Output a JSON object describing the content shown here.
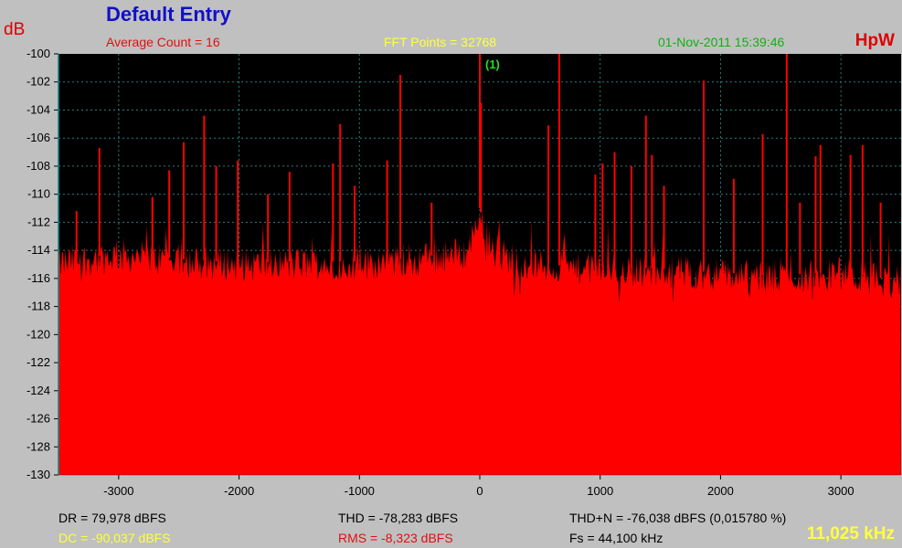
{
  "header": {
    "title": "Default Entry",
    "unit_label": "dB",
    "brand": "HpW",
    "average_count": "Average Count = 16",
    "fft_points": "FFT Points = 32768",
    "timestamp": "01-Nov-2011 15:39:46"
  },
  "stats": {
    "dr": "DR = 79,978 dBFS",
    "dc": "DC = -90,037 dBFS",
    "thd": "THD = -78,283 dBFS",
    "rms": "RMS = -8,323 dBFS",
    "thdn": "THD+N = -76,038 dBFS (0,015780 %)",
    "fs": "Fs = 44,100 kHz",
    "span": "11,025 kHz"
  },
  "colors": {
    "plot_bg": "#000000",
    "trace": "#ff0000",
    "grid": "#2e7d7d",
    "marker": "#20e020"
  },
  "chart_data": {
    "type": "area",
    "ylabel": "dB",
    "xlim": [
      -3500,
      3500
    ],
    "ylim": [
      -130,
      -100
    ],
    "y_ticks": [
      -100,
      -102,
      -104,
      -106,
      -108,
      -110,
      -112,
      -114,
      -116,
      -118,
      -120,
      -122,
      -124,
      -126,
      -128,
      -130
    ],
    "x_ticks": [
      -3000,
      -2000,
      -1000,
      0,
      1000,
      2000,
      3000
    ],
    "grid": true,
    "noise_floor": [
      {
        "x": -3500,
        "y": -114.8
      },
      {
        "x": -3000,
        "y": -114.2
      },
      {
        "x": -2500,
        "y": -114.6
      },
      {
        "x": -2000,
        "y": -114.9
      },
      {
        "x": -1500,
        "y": -114.8
      },
      {
        "x": -1000,
        "y": -114.8
      },
      {
        "x": -500,
        "y": -114.5
      },
      {
        "x": -100,
        "y": -114.0
      },
      {
        "x": 0,
        "y": -111.0
      },
      {
        "x": 100,
        "y": -114.0
      },
      {
        "x": 500,
        "y": -115.0
      },
      {
        "x": 1000,
        "y": -115.2
      },
      {
        "x": 1500,
        "y": -115.3
      },
      {
        "x": 2000,
        "y": -115.6
      },
      {
        "x": 2500,
        "y": -115.8
      },
      {
        "x": 3000,
        "y": -115.5
      },
      {
        "x": 3500,
        "y": -116.2
      }
    ],
    "peaks": [
      {
        "x": 0,
        "y": -100
      },
      {
        "x": 10,
        "y": -103.5
      },
      {
        "x": 660,
        "y": -100
      },
      {
        "x": 2550,
        "y": -100
      },
      {
        "x": -660,
        "y": -101.5
      },
      {
        "x": 1860,
        "y": -101.9
      },
      {
        "x": -2290,
        "y": -104.4
      },
      {
        "x": 1380,
        "y": -104.4
      },
      {
        "x": -1160,
        "y": -105.0
      },
      {
        "x": 570,
        "y": -105.1
      },
      {
        "x": 2350,
        "y": -105.7
      },
      {
        "x": -2460,
        "y": -106.3
      },
      {
        "x": 2830,
        "y": -106.5
      },
      {
        "x": 3180,
        "y": -106.5
      },
      {
        "x": -3160,
        "y": -106.7
      },
      {
        "x": 1120,
        "y": -107.0
      },
      {
        "x": 3080,
        "y": -107.2
      },
      {
        "x": 1430,
        "y": -107.2
      },
      {
        "x": 2790,
        "y": -107.3
      },
      {
        "x": -2010,
        "y": -107.6
      },
      {
        "x": -770,
        "y": -107.6
      },
      {
        "x": -1220,
        "y": -107.8
      },
      {
        "x": 1020,
        "y": -107.8
      },
      {
        "x": -2190,
        "y": -108.0
      },
      {
        "x": 1260,
        "y": -108.0
      },
      {
        "x": -2580,
        "y": -108.3
      },
      {
        "x": -1580,
        "y": -108.4
      },
      {
        "x": 960,
        "y": -108.6
      },
      {
        "x": 2110,
        "y": -108.9
      },
      {
        "x": -1040,
        "y": -109.4
      },
      {
        "x": 1530,
        "y": -109.4
      },
      {
        "x": -1760,
        "y": -110.0
      },
      {
        "x": -2720,
        "y": -110.2
      },
      {
        "x": -400,
        "y": -110.6
      },
      {
        "x": 2660,
        "y": -110.6
      },
      {
        "x": -3350,
        "y": -111.2
      },
      {
        "x": 3330,
        "y": -110.6
      }
    ],
    "annotations": [
      {
        "x": 0,
        "y": -100,
        "text": "(1)"
      }
    ]
  }
}
